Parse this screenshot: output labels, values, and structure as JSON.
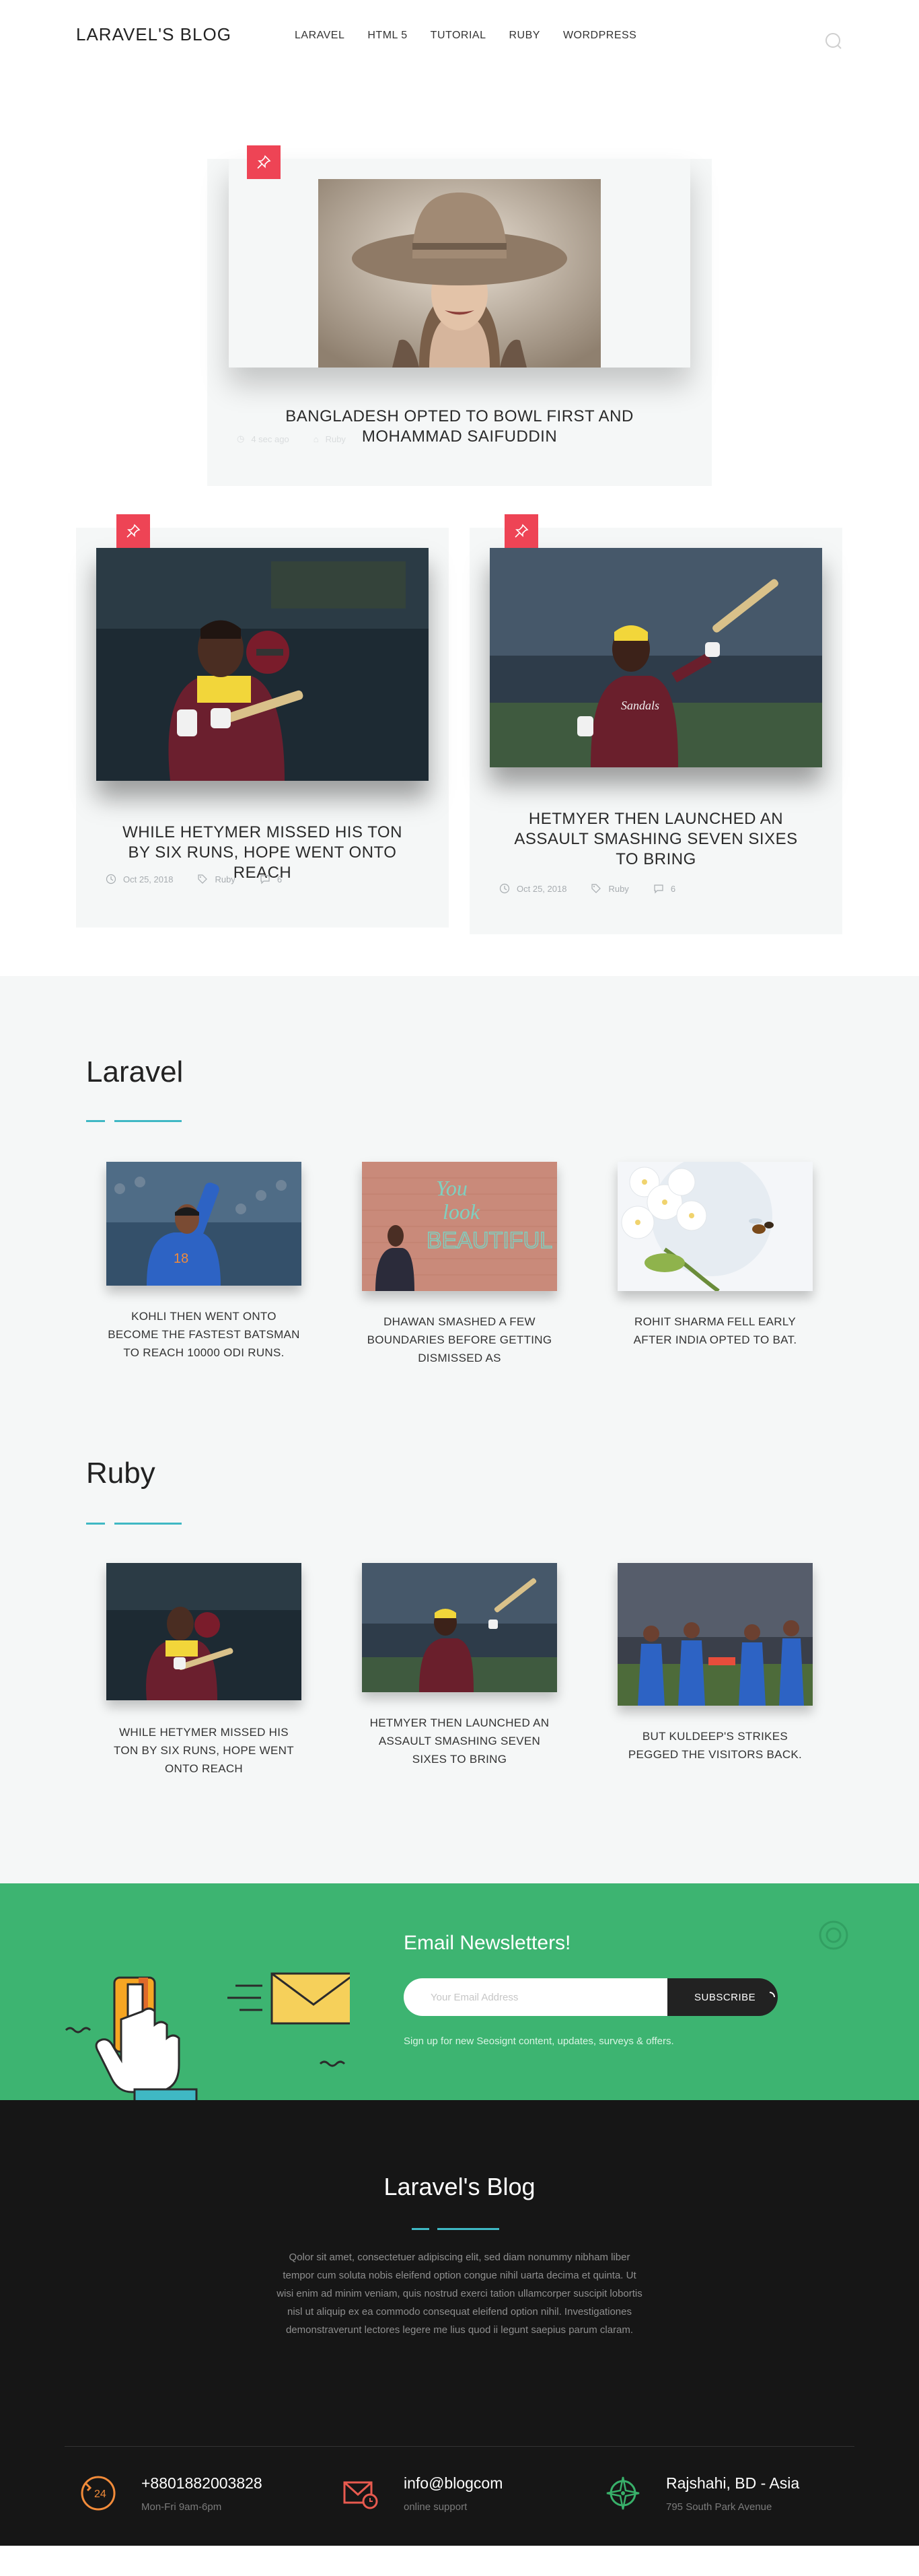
{
  "header": {
    "logo": "LARAVEL'S BLOG",
    "nav": [
      "LARAVEL",
      "HTML 5",
      "TUTORIAL",
      "RUBY",
      "WORDPRESS"
    ]
  },
  "featured": {
    "main": {
      "title": "BANGLADESH OPTED TO BOWL FIRST AND MOHAMMAD SAIFUDDIN",
      "meta_date": "4 sec ago",
      "meta_tag": "Ruby"
    },
    "left": {
      "title": "WHILE HETYMER MISSED HIS TON BY SIX RUNS, HOPE WENT ONTO REACH",
      "date": "Oct 25, 2018",
      "tag": "Ruby",
      "comments": "6"
    },
    "right": {
      "title": "HETMYER THEN LAUNCHED AN ASSAULT SMASHING SEVEN SIXES TO BRING",
      "date": "Oct 25, 2018",
      "tag": "Ruby",
      "comments": "6"
    }
  },
  "sections": [
    {
      "title": "Laravel",
      "posts": [
        "KOHLI THEN WENT ONTO BECOME THE FASTEST BATSMAN TO REACH 10000 ODI RUNS.",
        "DHAWAN SMASHED A FEW BOUNDARIES BEFORE GETTING DISMISSED AS",
        "ROHIT SHARMA FELL EARLY AFTER INDIA OPTED TO BAT."
      ],
      "wall_text": [
        "You",
        "look",
        "BEAUTIFUL"
      ]
    },
    {
      "title": "Ruby",
      "posts": [
        "WHILE HETYMER MISSED HIS TON BY SIX RUNS, HOPE WENT ONTO REACH",
        "HETMYER THEN LAUNCHED AN ASSAULT SMASHING SEVEN SIXES TO BRING",
        "BUT KULDEEP'S STRIKES PEGGED THE VISITORS BACK."
      ]
    }
  ],
  "newsletter": {
    "title": "Email Newsletters!",
    "placeholder": "Your Email Address",
    "button": "SUBSCRIBE",
    "note": "Sign up for new Seosignt content, updates, surveys & offers."
  },
  "footer": {
    "title": "Laravel's Blog",
    "text": "Qolor sit amet, consectetuer adipiscing elit, sed diam nonummy nibham liber tempor cum soluta nobis eleifend option congue nihil uarta decima et quinta. Ut wisi enim ad minim veniam, quis nostrud exerci tation ullamcorper suscipit lobortis nisl ut aliquip ex ea commodo consequat eleifend option nihil. Investigationes demonstraverunt lectores legere me lius quod ii legunt saepius parum claram.",
    "contacts": [
      {
        "main": "+8801882003828",
        "sub": "Mon-Fri 9am-6pm",
        "icon": "phone-24-icon"
      },
      {
        "main": "info@blogcom",
        "sub": "online support",
        "icon": "mail-clock-icon"
      },
      {
        "main": "Rajshahi, BD - Asia",
        "sub": "795 South Park Avenue",
        "icon": "compass-icon"
      }
    ]
  },
  "colors": {
    "accent_red": "#ee4455",
    "accent_teal": "#3fb8c4",
    "newsletter_green": "#3db471",
    "footer_bg": "#161616",
    "contact_orange": "#f28b3a",
    "contact_red": "#e85a4f",
    "contact_green": "#38b06a"
  }
}
